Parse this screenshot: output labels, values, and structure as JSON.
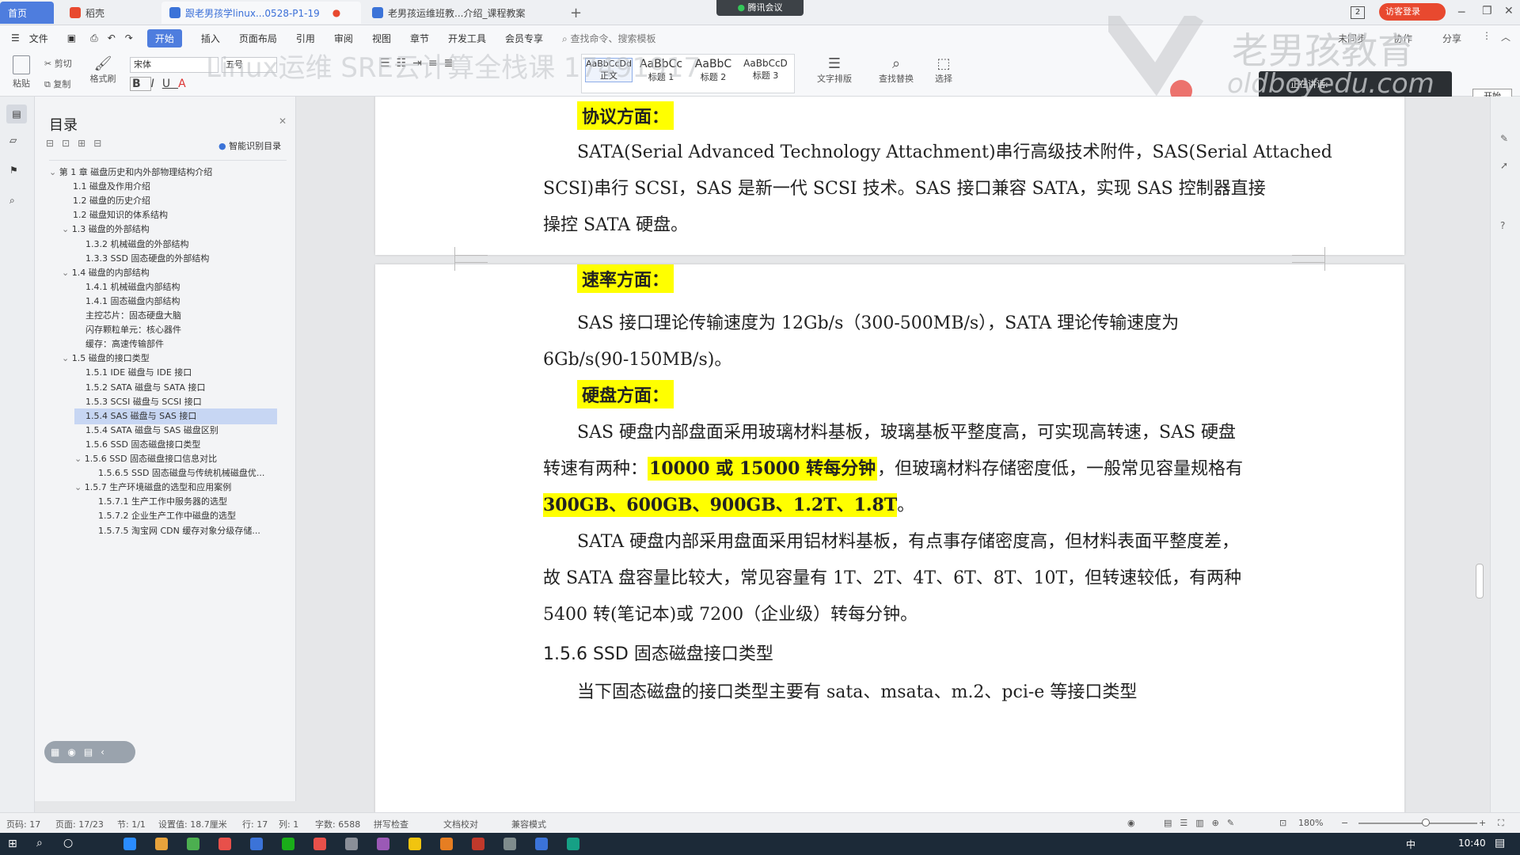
{
  "titlebar": {
    "tabs": [
      {
        "label": "首页",
        "active": true
      },
      {
        "label": "稻壳"
      },
      {
        "label": "跟老男孩学linux...0528-P1-19"
      },
      {
        "label": "老男孩运维班教...介绍_课程教案"
      }
    ],
    "add_tab": "+",
    "meeting": "腾讯会议",
    "badge": "2",
    "login": "访客登录"
  },
  "menubar": {
    "file": "文件",
    "items": [
      "开始",
      "插入",
      "页面布局",
      "引用",
      "审阅",
      "视图",
      "章节",
      "开发工具",
      "会员专享"
    ],
    "search_placeholder": "查找命令、搜索模板",
    "right": [
      "未同步",
      "协作",
      "分享"
    ]
  },
  "ribbon": {
    "paste": "粘贴",
    "cut": "剪切",
    "copy": "复制",
    "format_painter": "格式刷",
    "font_name": "宋体",
    "font_size": "五号",
    "styles": [
      {
        "sample": "AaBbCcDd",
        "name": "正文"
      },
      {
        "sample": "AaBbCc",
        "name": "标题 1"
      },
      {
        "sample": "AaBbC",
        "name": "标题 2"
      },
      {
        "sample": "AaBbCcD",
        "name": "标题 3"
      }
    ],
    "text_layout": "文字排版",
    "find_replace": "查找替换",
    "select": "选择",
    "speaking": "正在讲话:",
    "start_btn": "开始"
  },
  "watermark": {
    "brand": "老男孩教育",
    "site": "oldboyedu.com",
    "overlay": "Linux运维 SRE云计算全栈课 17491917"
  },
  "toc": {
    "title": "目录",
    "smart": "智能识别目录",
    "items": [
      {
        "label": "第 1 章   磁盘历史和内外部物理结构介绍",
        "level": 0,
        "arrow": "v"
      },
      {
        "label": "1.1 磁盘及作用介绍",
        "level": 1
      },
      {
        "label": "1.2 磁盘的历史介绍",
        "level": 1
      },
      {
        "label": "1.2 磁盘知识的体系结构",
        "level": 1
      },
      {
        "label": "1.3 磁盘的外部结构",
        "level": 1,
        "arrow": "v"
      },
      {
        "label": "1.3.2 机械磁盘的外部结构",
        "level": 2
      },
      {
        "label": "1.3.3 SSD 固态硬盘的外部结构",
        "level": 2
      },
      {
        "label": "1.4 磁盘的内部结构",
        "level": 1,
        "arrow": "v"
      },
      {
        "label": "1.4.1 机械磁盘内部结构",
        "level": 2
      },
      {
        "label": "1.4.1 固态磁盘内部结构",
        "level": 2
      },
      {
        "label": "主控芯片：固态硬盘大脑",
        "level": 2
      },
      {
        "label": "闪存颗粒单元：核心器件",
        "level": 2
      },
      {
        "label": "缓存：高速传输部件",
        "level": 2
      },
      {
        "label": "1.5 磁盘的接口类型",
        "level": 1,
        "arrow": "v"
      },
      {
        "label": "1.5.1 IDE 磁盘与 IDE 接口",
        "level": 2
      },
      {
        "label": "1.5.2 SATA 磁盘与 SATA 接口",
        "level": 2
      },
      {
        "label": "1.5.3 SCSI 磁盘与 SCSI 接口",
        "level": 2
      },
      {
        "label": "1.5.4 SAS 磁盘与 SAS 接口",
        "level": 2,
        "selected": true
      },
      {
        "label": "1.5.4 SATA 磁盘与 SAS 磁盘区别",
        "level": 2
      },
      {
        "label": "1.5.6 SSD 固态磁盘接口类型",
        "level": 2
      },
      {
        "label": "1.5.6 SSD 固态磁盘接口信息对比",
        "level": 2,
        "arrow": "v"
      },
      {
        "label": "1.5.6.5 SSD 固态磁盘与传统机械磁盘优...",
        "level": 3
      },
      {
        "label": "1.5.7 生产环境磁盘的选型和应用案例",
        "level": 2,
        "arrow": "v"
      },
      {
        "label": "1.5.7.1 生产工作中服务器的选型",
        "level": 3
      },
      {
        "label": "1.5.7.2 企业生产工作中磁盘的选型",
        "level": 3
      },
      {
        "label": "1.5.7.5 淘宝网 CDN 缓存对象分级存储...",
        "level": 3
      }
    ]
  },
  "doc": {
    "h_protocol": "协议方面：",
    "p1_l1": "SATA(Serial Advanced Technology Attachment)串行高级技术附件，SAS(Serial Attached",
    "p1_l2": "SCSI)串行 SCSI，SAS 是新一代 SCSI 技术。SAS 接口兼容 SATA，实现 SAS 控制器直接",
    "p1_l3": "操控 SATA 硬盘。",
    "h_speed": "速率方面：",
    "p2_l1": "SAS 接口理论传输速度为 12Gb/s（300-500MB/s），SATA 理论传输速度为",
    "p2_l2": "6Gb/s(90-150MB/s)。",
    "h_disk": "硬盘方面：",
    "p3_l1": "SAS 硬盘内部盘面采用玻璃材料基板，玻璃基板平整度高，可实现高转速，SAS 硬盘",
    "p3_l2a": "转速有两种：",
    "p3_l2b": "10000 或 15000 转每分钟",
    "p3_l2c": "，但玻璃材料存储密度低，一般常见容量规格有",
    "p3_l3a": "300GB、600GB、900GB、1.2T、1.8T",
    "p3_l3b": "。",
    "p4_l1": "SATA 硬盘内部采用盘面采用铝材料基板，有点事存储密度高，但材料表面平整度差，",
    "p4_l2": "故 SATA 盘容量比较大，常见容量有 1T、2T、4T、6T、8T、10T，但转速较低，有两种",
    "p4_l3": "5400 转(笔记本)或 7200（企业级）转每分钟。",
    "h_ssd": "1.5.6 SSD 固态磁盘接口类型",
    "p5_l1": "当下固态磁盘的接口类型主要有 sata、msata、m.2、pci-e 等接口类型"
  },
  "status": {
    "page_num": "页码: 17",
    "pages": "页面: 17/23",
    "section": "节: 1/1",
    "setting": "设置值: 18.7厘米",
    "row": "行: 17",
    "col": "列: 1",
    "words": "字数: 6588",
    "spell": "拼写检查",
    "proof": "文档校对",
    "compat": "兼容模式",
    "zoom": "180%"
  },
  "taskbar": {
    "time": "10:40",
    "ime": "中"
  }
}
